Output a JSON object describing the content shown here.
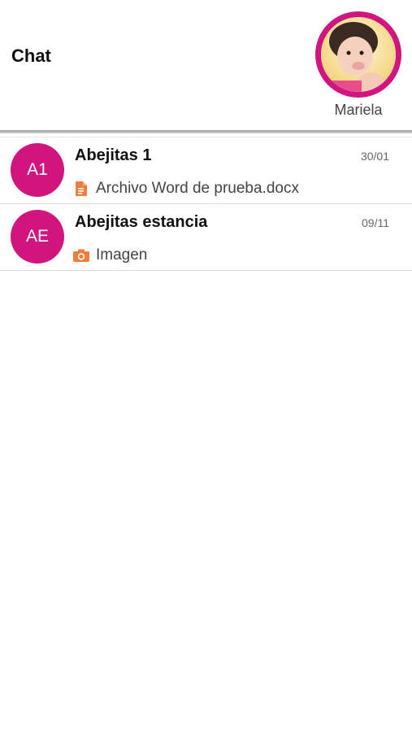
{
  "header": {
    "title": "Chat",
    "profile": {
      "name": "Mariela"
    }
  },
  "chats": [
    {
      "initials": "A1",
      "name": "Abejitas 1",
      "date": "30/01",
      "preview_icon": "document-icon",
      "preview": "Archivo Word de prueba.docx"
    },
    {
      "initials": "AE",
      "name": "Abejitas estancia",
      "date": "09/11",
      "preview_icon": "camera-icon",
      "preview": "Imagen"
    }
  ],
  "colors": {
    "accent": "#d0157f",
    "icon": "#ef7d3c"
  }
}
